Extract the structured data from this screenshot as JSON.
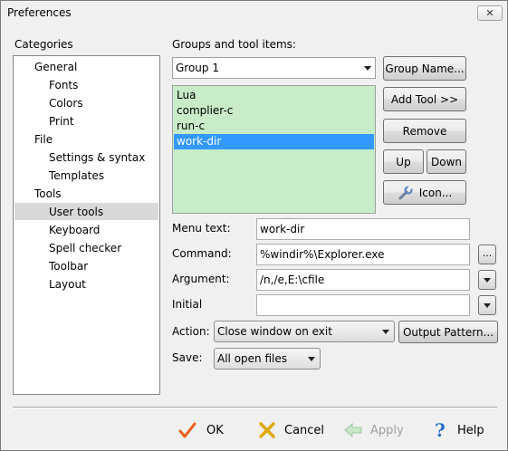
{
  "window": {
    "title": "Preferences",
    "close_glyph": "✕"
  },
  "categories": {
    "label": "Categories",
    "items": [
      {
        "label": "General",
        "level": 0
      },
      {
        "label": "Fonts",
        "level": 1
      },
      {
        "label": "Colors",
        "level": 1
      },
      {
        "label": "Print",
        "level": 1
      },
      {
        "label": "File",
        "level": 0
      },
      {
        "label": "Settings & syntax",
        "level": 1
      },
      {
        "label": "Templates",
        "level": 1
      },
      {
        "label": "Tools",
        "level": 0
      },
      {
        "label": "User tools",
        "level": 1,
        "selected": true
      },
      {
        "label": "Keyboard",
        "level": 1
      },
      {
        "label": "Spell checker",
        "level": 1
      },
      {
        "label": "Toolbar",
        "level": 1
      },
      {
        "label": "Layout",
        "level": 1
      }
    ]
  },
  "groups": {
    "label": "Groups and tool items:",
    "group_selected": "Group 1",
    "group_name_button": "Group Name...",
    "items": [
      "Lua",
      "complier-c",
      "run-c",
      "work-dir"
    ],
    "selected_item": "work-dir",
    "list_background": "#c8ecc8"
  },
  "buttons": {
    "add_tool": "Add Tool >>",
    "remove": "Remove",
    "up": "Up",
    "down": "Down",
    "icon": "Icon...",
    "browse": "...",
    "output_pattern": "Output Pattern..."
  },
  "form": {
    "menu_text_label": "Menu text:",
    "menu_text_value": "work-dir",
    "command_label": "Command:",
    "command_value": "%windir%\\Explorer.exe",
    "argument_label": "Argument:",
    "argument_value": "/n,/e,E:\\cfile",
    "initial_label": "Initial",
    "initial_value": "",
    "action_label": "Action:",
    "action_value": "Close window on exit",
    "save_label": "Save:",
    "save_value": "All open files"
  },
  "footer": {
    "ok": "OK",
    "cancel": "Cancel",
    "apply": "Apply",
    "help": "Help",
    "ok_icon": "checkmark-icon",
    "cancel_icon": "cross-icon",
    "apply_icon": "arrow-left-icon",
    "help_icon": "question-mark-icon",
    "ok_color": "#e8601c",
    "cancel_color": "#e0a800",
    "help_color": "#2a6fc9"
  }
}
